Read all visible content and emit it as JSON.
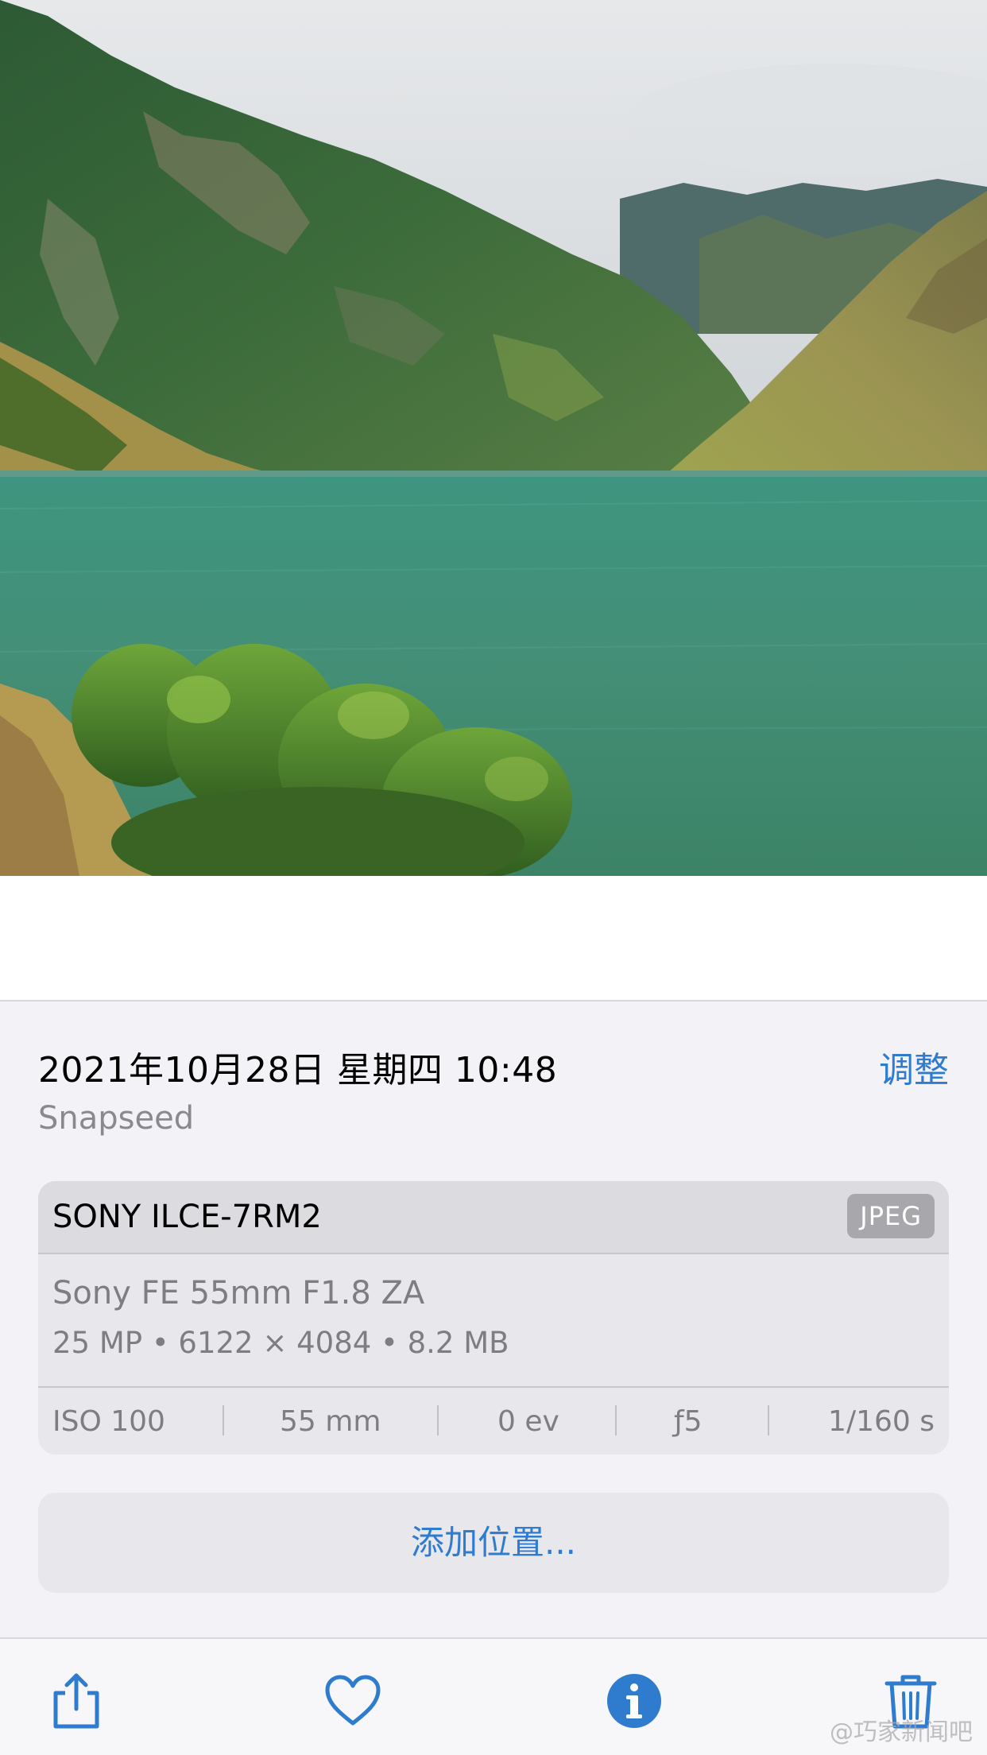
{
  "photo": {
    "description_icon": "landscape-photo"
  },
  "info": {
    "datetime": "2021年10月28日 星期四 10:48",
    "adjust_label": "调整",
    "source_app": "Snapseed"
  },
  "metadata": {
    "camera_model": "SONY ILCE-7RM2",
    "format": "JPEG",
    "lens": "Sony FE 55mm F1.8 ZA",
    "specs": "25 MP  •  6122 × 4084  •  8.2 MB",
    "exif": {
      "iso": "ISO 100",
      "focal_length": "55 mm",
      "exposure": "0 ev",
      "aperture": "ƒ5",
      "shutter": "1/160 s"
    }
  },
  "location": {
    "add_label": "添加位置..."
  },
  "toolbar": {
    "share_icon": "share-icon",
    "favorite_icon": "heart-icon",
    "info_icon": "info-icon",
    "delete_icon": "trash-icon"
  },
  "watermark": {
    "text": "@巧家新闻吧"
  },
  "colors": {
    "accent": "#2f7ccf",
    "sheet_background": "#f2f2f7",
    "card_background": "#e8e7ec"
  }
}
